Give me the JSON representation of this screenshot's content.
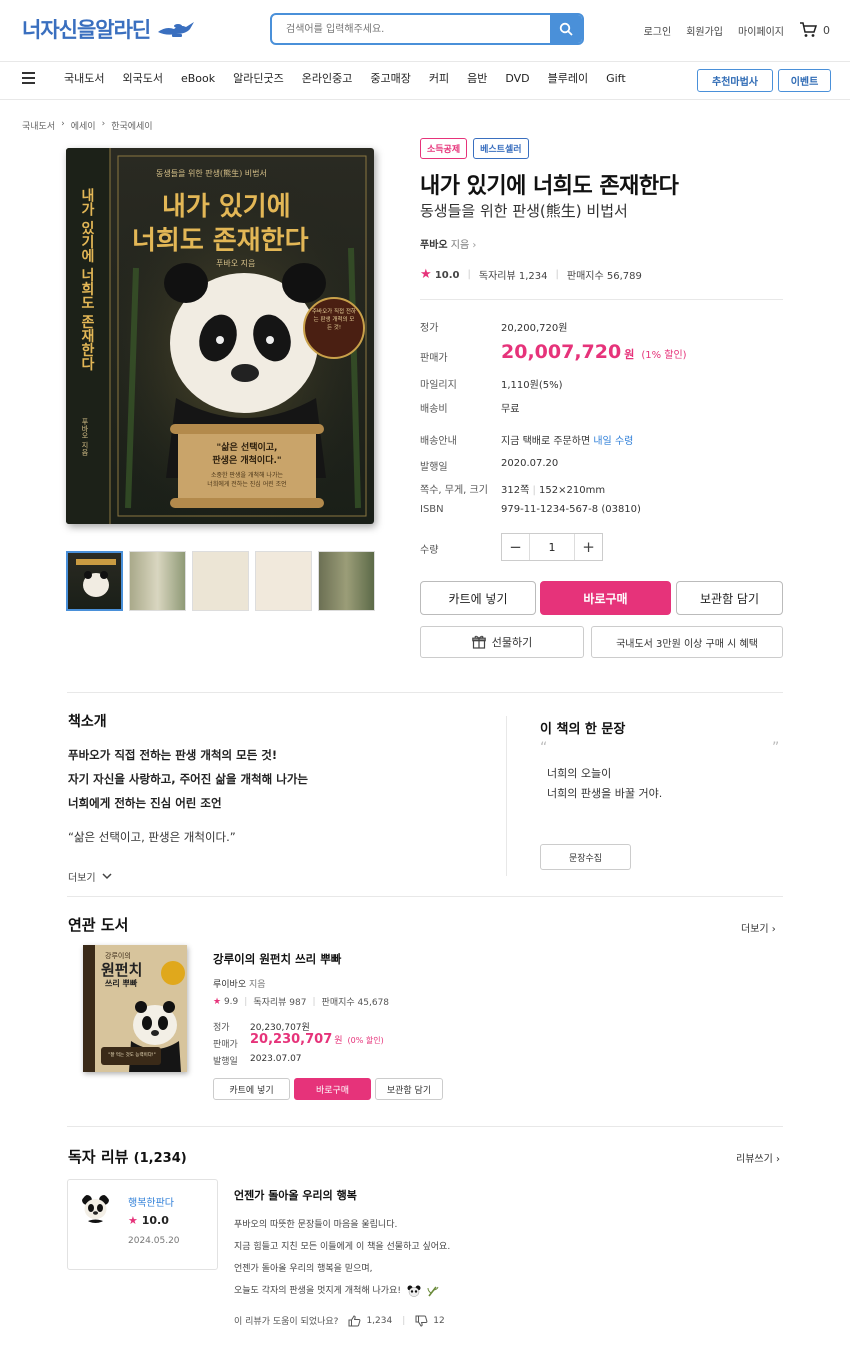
{
  "header": {
    "logo": "너자신을알라딘",
    "search_placeholder": "검색어를 입력해주세요.",
    "links": [
      "로그인",
      "회원가입",
      "마이페이지"
    ],
    "cart_count": "0"
  },
  "nav": {
    "items": [
      "국내도서",
      "외국도서",
      "eBook",
      "알라딘굿즈",
      "온라인중고",
      "중고매장",
      "커피",
      "음반",
      "DVD",
      "블루레이",
      "Gift"
    ],
    "btn_recommend": "추천마법사",
    "btn_event": "이벤트"
  },
  "breadcrumb": [
    "국내도서",
    "에세이",
    "한국에세이"
  ],
  "cover": {
    "top_small": "동생들을 위한 판생(熊生) 비법서",
    "title_line1": "내가 있기에",
    "title_line2": "너희도 존재한다",
    "author_line": "푸바오 지음",
    "spine_text": "내가 있기에 너희도 존재한다",
    "spine_author": "푸바오 지음",
    "seal_text": "주바오가 직접 전하는 판생 개척의 모든 것!",
    "scroll_line1": "\"삶은 선택이고,",
    "scroll_line2": "판생은 개척이다.\"",
    "scroll_small1": "소중한 판생을 개척해 나가는",
    "scroll_small2": "너희에게 전하는 진심 어린 조언"
  },
  "product": {
    "badge1": "소득공제",
    "badge2": "베스트셀러",
    "title": "내가 있기에 너희도 존재한다",
    "subtitle": "동생들을 위한 판생(熊生) 비법서",
    "author": "푸바오",
    "author_suffix": "지음",
    "rating": "10.0",
    "review_count": "독자리뷰 1,234",
    "sales_index": "판매지수 56,789",
    "price_label": "정가",
    "price": "20,200,720원",
    "sale_label": "판매가",
    "sale_price": "20,007,720",
    "sale_unit": "원",
    "discount": "(1% 할인)",
    "mileage_label": "마일리지",
    "mileage": "1,110원(5%)",
    "shipping_label": "배송비",
    "shipping": "무료",
    "delivery_label": "배송안내",
    "delivery_text": "지금 택배로 주문하면",
    "delivery_highlight": "내일 수령",
    "pubdate_label": "발행일",
    "pubdate": "2020.07.20",
    "pages_label": "쪽수, 무게, 크기",
    "pages": "312쪽",
    "size": "152×210mm",
    "isbn_label": "ISBN",
    "isbn": "979-11-1234-567-8 (03810)",
    "qty_label": "수량",
    "qty": "1",
    "btn_cart": "카트에 넣기",
    "btn_buy": "바로구매",
    "btn_save": "보관함 담기",
    "btn_gift": "선물하기",
    "btn_benefit": "국내도서 3만원 이상 구매 시 혜택"
  },
  "intro": {
    "title": "책소개",
    "line1": "푸바오가 직접 전하는 판생 개척의 모든 것!",
    "line2": "자기 자신을 사랑하고, 주어진 삶을 개척해 나가는",
    "line3": "너희에게 전하는 진심 어린 조언",
    "quote": "“삶은 선택이고, 판생은 개척이다.”",
    "more": "더보기",
    "sentence_title": "이 책의 한 문장",
    "sentence1": "너희의 오늘이",
    "sentence2": "너희의 판생을 바꿀 거야.",
    "collect_btn": "문장수집"
  },
  "related": {
    "title": "연관 도서",
    "more": "더보기",
    "book_title": "강루이의 원펀치 쓰리 뿌빠",
    "author": "루이바오",
    "author_suffix": "지음",
    "rating": "9.9",
    "review_count": "독자리뷰 987",
    "sales_index": "판매지수 45,678",
    "price_label": "정가",
    "price": "20,230,707원",
    "sale_label": "판매가",
    "sale_price": "20,230,707",
    "sale_unit": "원",
    "discount": "(0% 할인)",
    "pubdate_label": "발행일",
    "pubdate": "2023.07.07",
    "btn_cart": "카트에 넣기",
    "btn_buy": "바로구매",
    "btn_save": "보관함 담기",
    "cover_line1": "강루이의",
    "cover_line2": "원펀치",
    "cover_line3": "쓰리 뿌빠",
    "cover_quote": "\"잘 먹는 것도 능력이다!\""
  },
  "review": {
    "title": "독자 리뷰",
    "count": "(1,234)",
    "write": "리뷰쓰기",
    "nickname": "행복한판다",
    "rating": "10.0",
    "date": "2024.05.20",
    "headline": "언젠가 돌아올 우리의 행복",
    "line1": "푸바오의 따뜻한 문장들이 마음을 울립니다.",
    "line2": "지금 힘들고 지친 모든 이들에게 이 책을 선물하고 싶어요.",
    "line3": "언젠가 돌아올 우리의 행복을 믿으며,",
    "line4": "오늘도 각자의 판생을 멋지게 개척해 나가요!",
    "helpful": "이 리뷰가 도움이 되었나요?",
    "likes": "1,234",
    "dislikes": "12"
  },
  "colors": {
    "brand_blue": "#3a6fbf",
    "accent_pink": "#e6337a",
    "link_blue": "#2f7fd8"
  }
}
